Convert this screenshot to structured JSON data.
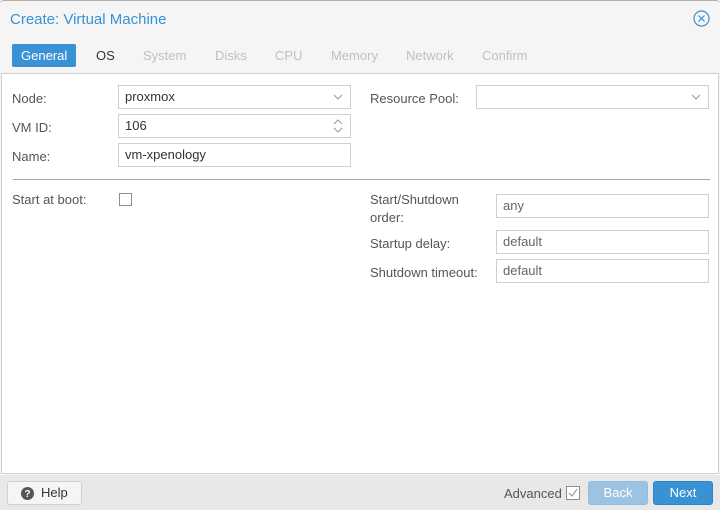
{
  "window": {
    "title": "Create: Virtual Machine",
    "close_icon": "circle-x-icon"
  },
  "tabs": [
    {
      "label": "General",
      "state": "active"
    },
    {
      "label": "OS",
      "state": "enabled"
    },
    {
      "label": "System",
      "state": "disabled"
    },
    {
      "label": "Disks",
      "state": "disabled"
    },
    {
      "label": "CPU",
      "state": "disabled"
    },
    {
      "label": "Memory",
      "state": "disabled"
    },
    {
      "label": "Network",
      "state": "disabled"
    },
    {
      "label": "Confirm",
      "state": "disabled"
    }
  ],
  "form": {
    "node": {
      "label": "Node:",
      "value": "proxmox"
    },
    "vmid": {
      "label": "VM ID:",
      "value": "106"
    },
    "name": {
      "label": "Name:",
      "value": "vm-xpenology"
    },
    "resource_pool": {
      "label": "Resource Pool:",
      "value": ""
    },
    "start_at_boot": {
      "label": "Start at boot:",
      "checked": false
    },
    "start_shutdown_order": {
      "label_line1": "Start/Shutdown",
      "label_line2": "order:",
      "placeholder": "any"
    },
    "startup_delay": {
      "label": "Startup delay:",
      "placeholder": "default"
    },
    "shutdown_timeout": {
      "label": "Shutdown timeout:",
      "placeholder": "default"
    }
  },
  "footer": {
    "help_label": "Help",
    "help_icon": "question-circle-icon",
    "advanced_label": "Advanced",
    "advanced_checked": true,
    "back_label": "Back",
    "next_label": "Next"
  },
  "colors": {
    "accent": "#3892d4",
    "accent_disabled": "#9cc3e2"
  }
}
